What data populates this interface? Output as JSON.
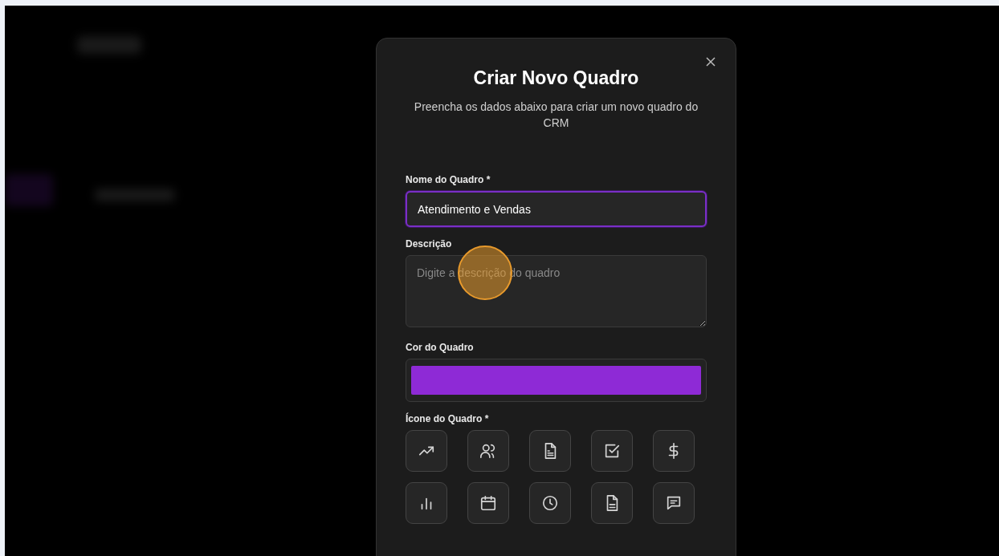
{
  "dialog": {
    "title": "Criar Novo Quadro",
    "subtitle": "Preencha os dados abaixo para criar um novo quadro do CRM",
    "fields": [
      {
        "kind": "text",
        "label": "Nome do Quadro *",
        "value": "Atendimento e Vendas",
        "focused": true
      },
      {
        "kind": "textarea",
        "label": "Descrição",
        "placeholder": "Digite a descrição do quadro",
        "focused": false
      },
      {
        "kind": "color",
        "label": "Cor do Quadro",
        "color": "#8e2ad6"
      },
      {
        "kind": "icons",
        "label": "Ícone do Quadro *",
        "items": [
          {
            "kind": "trend",
            "selected": false
          },
          {
            "kind": "users",
            "selected": false
          },
          {
            "kind": "doc",
            "selected": false
          },
          {
            "kind": "check",
            "selected": false
          },
          {
            "kind": "dollar",
            "selected": false
          },
          {
            "kind": "bars",
            "selected": false
          },
          {
            "kind": "calendar",
            "selected": false
          },
          {
            "kind": "clock",
            "selected": false
          },
          {
            "kind": "file",
            "selected": false
          },
          {
            "kind": "message",
            "selected": false
          }
        ]
      }
    ]
  }
}
